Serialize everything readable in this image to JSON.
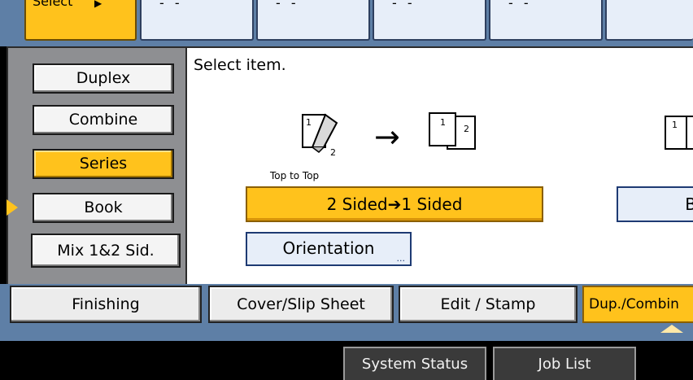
{
  "top_tabs": {
    "select_label": "Select",
    "dash_text": "- -"
  },
  "left_menu": {
    "items": [
      {
        "label": "Duplex"
      },
      {
        "label": "Combine"
      },
      {
        "label": "Series"
      },
      {
        "label": "Book"
      },
      {
        "label": "Mix 1&2 Sid."
      }
    ],
    "selected": "Series"
  },
  "content": {
    "prompt": "Select item.",
    "orientation_caption": "Top to Top",
    "duplex_mode_label": "2 Sided➔1 Sided",
    "book_label": "B",
    "orientation_label": "Orientation",
    "orientation_more": "...",
    "source_page_numbers": [
      "1",
      "2"
    ],
    "result_page_numbers": [
      "1",
      "2"
    ],
    "book_page_number": "1",
    "arrow_symbol": "→"
  },
  "bottom_tabs": {
    "items": [
      {
        "label": "Finishing"
      },
      {
        "label": "Cover/Slip Sheet"
      },
      {
        "label": "Edit / Stamp"
      },
      {
        "label": "Dup./Combin"
      }
    ],
    "selected": "Dup./Combin"
  },
  "status_bar": {
    "system_status_label": "System Status",
    "job_list_label": "Job List"
  },
  "colors": {
    "selected_accent": "#ffc21c",
    "panel_bg": "#5e7fa6",
    "button_bg": "#e7eef9"
  }
}
